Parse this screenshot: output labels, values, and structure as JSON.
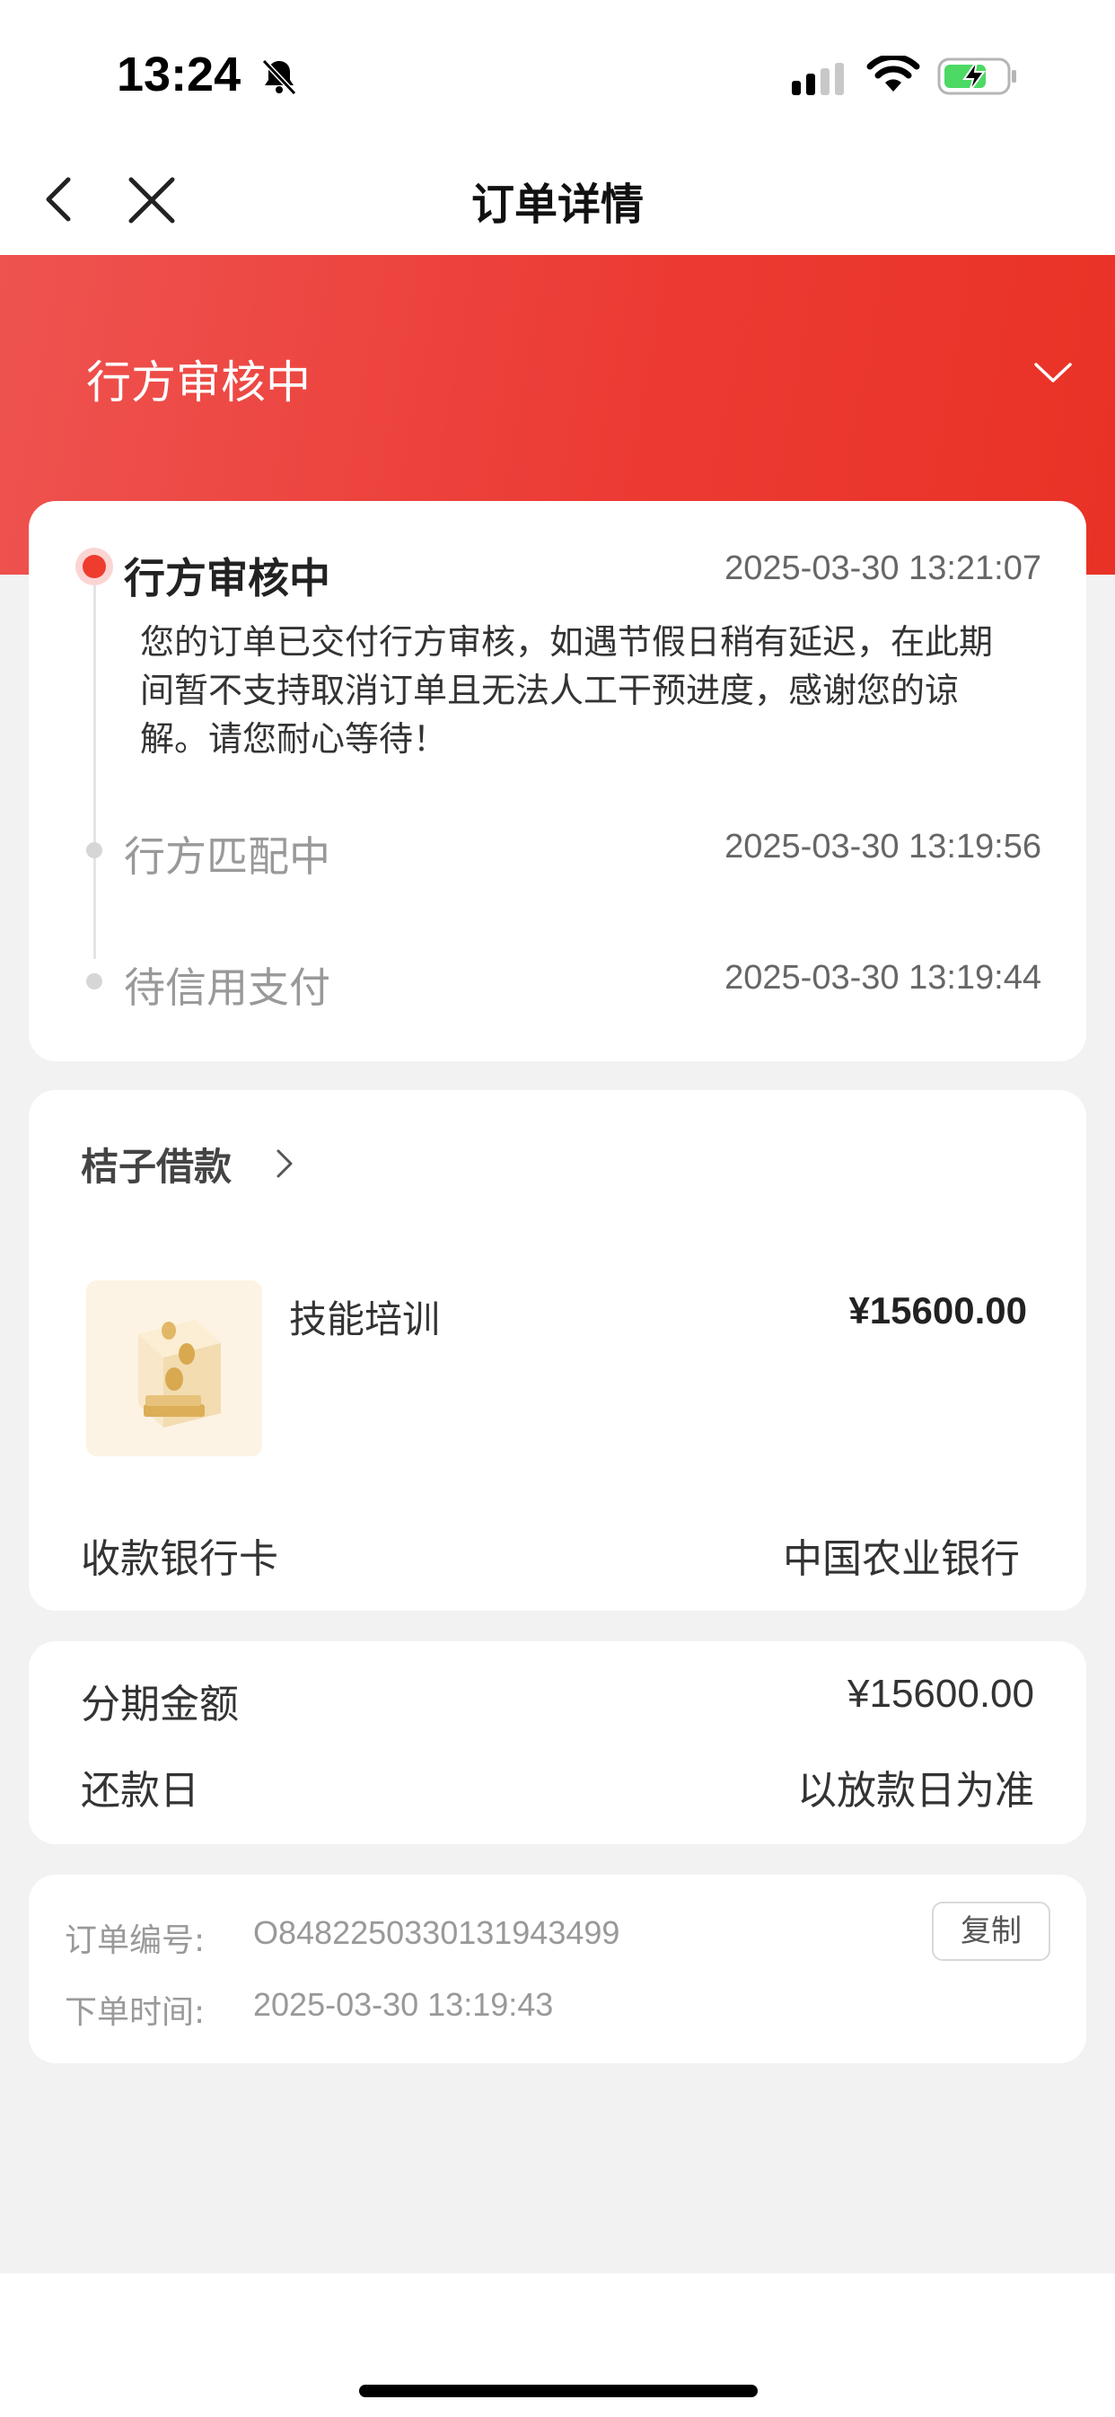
{
  "status_bar": {
    "time": "13:24",
    "icons": [
      "bell-slash-icon",
      "signal-icon",
      "wifi-icon",
      "battery-charging-icon"
    ]
  },
  "nav": {
    "title": "订单详情",
    "icons": [
      "back-icon",
      "close-icon"
    ]
  },
  "hero": {
    "status": "行方审核中",
    "icon": "chevron-down-icon",
    "colors": [
      "#ee5350",
      "#e93226"
    ]
  },
  "timeline": {
    "active": {
      "title": "行方审核中",
      "time": "2025-03-30 13:21:07",
      "description": "您的订单已交付行方审核，如遇节假日稍有延迟，在此期间暂不支持取消订单且无法人工干预进度，感谢您的谅解。请您耐心等待！"
    },
    "steps": [
      {
        "title": "行方匹配中",
        "time": "2025-03-30 13:19:56"
      },
      {
        "title": "待信用支付",
        "time": "2025-03-30 13:19:44"
      }
    ]
  },
  "product": {
    "merchant": "桔子借款",
    "name": "技能培训",
    "price": "¥15600.00",
    "bank_label": "收款银行卡",
    "bank_value": "中国农业银行"
  },
  "installment": {
    "amount_label": "分期金额",
    "amount_value": "¥15600.00",
    "repay_label": "还款日",
    "repay_value": "以放款日为准"
  },
  "order": {
    "number_label": "订单编号:",
    "number_value": "O8482250330131943499",
    "copy_label": "复制",
    "time_label": "下单时间:",
    "time_value": "2025-03-30 13:19:43"
  },
  "colors": {
    "accent": "#ee3c2f",
    "background": "#f2f2f2"
  }
}
